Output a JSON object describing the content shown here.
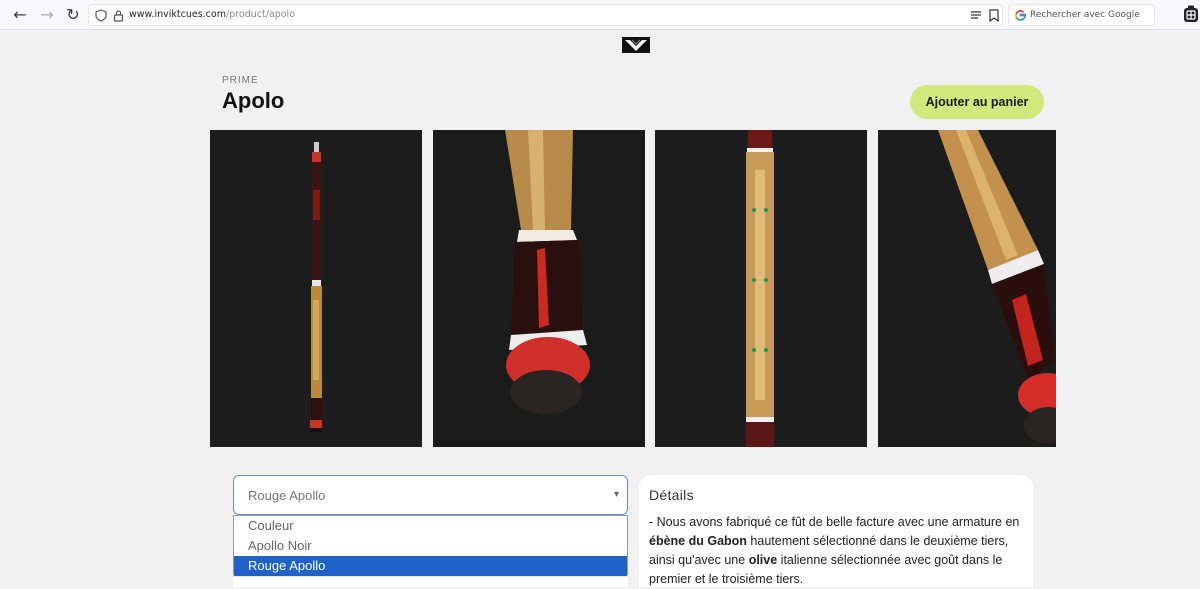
{
  "browser": {
    "url_host": "www.inviktcues.com",
    "url_path": "/product/apolo",
    "search_placeholder": "Rechercher avec Google"
  },
  "product": {
    "category": "PRIME",
    "title": "Apolo",
    "add_to_cart": "Ajouter au panier"
  },
  "photos": [
    {
      "name": "full cue"
    },
    {
      "name": "joint close-up"
    },
    {
      "name": "butt inlay close-up"
    },
    {
      "name": "angled close-up"
    }
  ],
  "color_select": {
    "current": "Rouge Apollo",
    "options": [
      "Couleur",
      "Apollo Noir",
      "Rouge Apollo"
    ],
    "selected_index": 2
  },
  "details": {
    "heading": "Détails",
    "text_1": "- Nous avons fabriqué ce fût de belle facture avec une armature en ",
    "bold_1": "ébène du Gabon",
    "text_2": " hautement sélectionné dans le deuxième tiers, ainsi qu'avec une ",
    "bold_2": "olive",
    "text_3": " italienne sélectionnée avec goût dans le premier et le troisième tiers."
  },
  "colors": {
    "accent": "#d3e87c",
    "select_highlight": "#1e62c8"
  }
}
